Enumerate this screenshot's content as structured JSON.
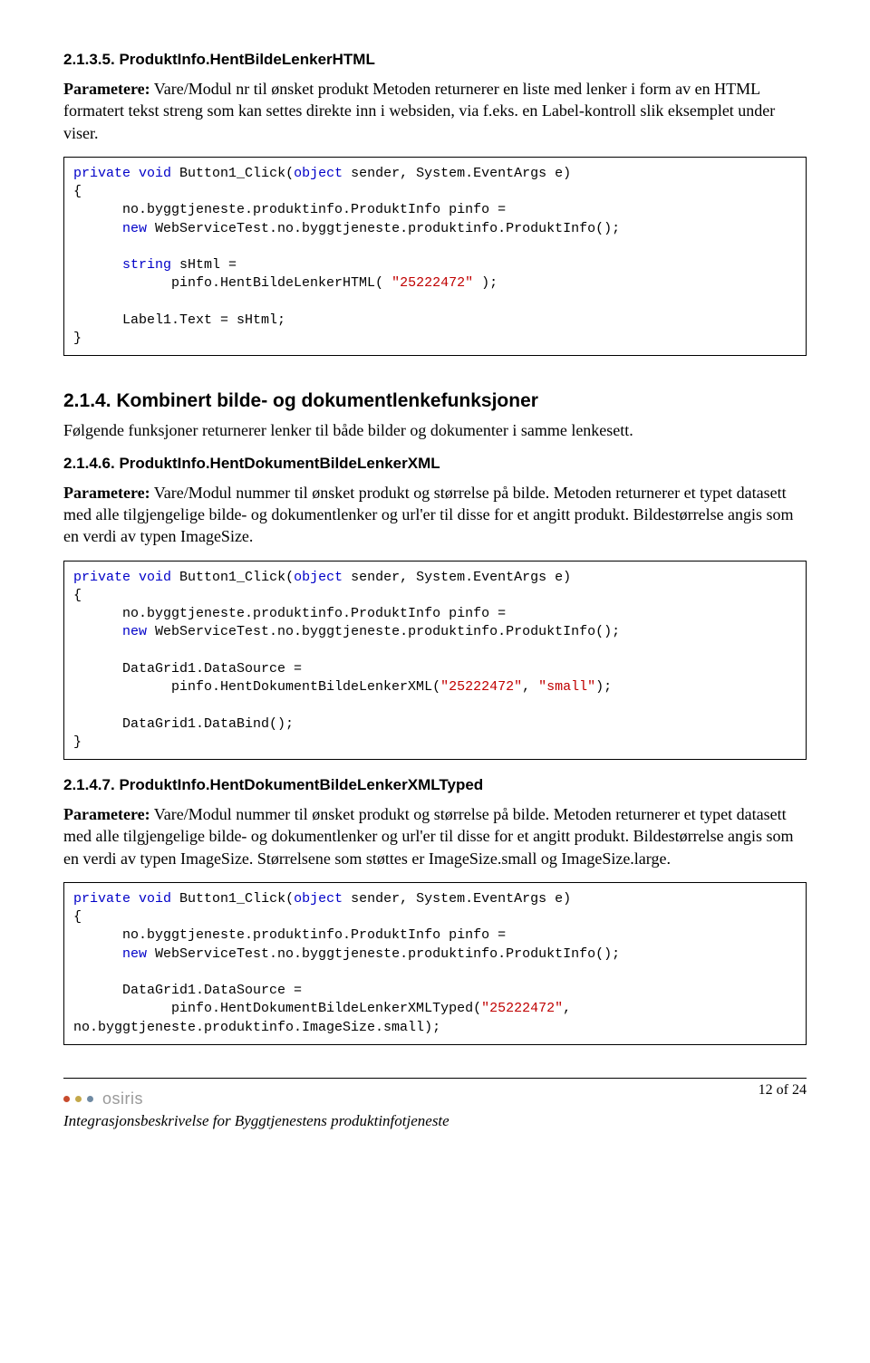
{
  "s1": {
    "num": "2.1.3.5.",
    "title": "ProduktInfo.HentBildeLenkerHTML",
    "para": {
      "label": "Parametere:",
      "rest": " Vare/Modul nr til ønsket produkt\nMetoden returnerer en liste med lenker i form av en HTML formatert tekst streng som kan settes direkte inn i websiden, via f.eks. en Label-kontroll slik eksemplet under viser."
    },
    "code": {
      "kw_private": "private",
      "kw_void": "void",
      "sig": " Button1_Click(",
      "kw_object": "object",
      "sig2": " sender, System.EventArgs e)",
      "l2": "{",
      "l3a": "      no.byggtjeneste.produktinfo.ProduktInfo pinfo = ",
      "kw_new": "new",
      "l4b": " WebServiceTest.no.byggtjeneste.produktinfo.ProduktInfo();",
      "kw_string": "string",
      "l6b": " sHtml = ",
      "l7a": "            pinfo.HentBildeLenkerHTML( ",
      "str1": "\"25222472\"",
      "l7b": " );",
      "l9": "      Label1.Text = sHtml;",
      "l10": "}"
    }
  },
  "s2": {
    "num": "2.1.4.",
    "title": "Kombinert bilde- og dokumentlenkefunksjoner",
    "para": "Følgende funksjoner returnerer lenker til både bilder og dokumenter i samme lenkesett."
  },
  "s3": {
    "num": "2.1.4.6.",
    "title": "ProduktInfo.HentDokumentBildeLenkerXML",
    "para": {
      "label": "Parametere:",
      "rest": " Vare/Modul nummer til ønsket produkt og størrelse på bilde.\nMetoden returnerer et typet datasett med alle tilgjengelige bilde- og dokumentlenker og url'er til disse for et angitt produkt. Bildestørrelse angis som en verdi av typen ImageSize."
    },
    "code": {
      "l6": "      DataGrid1.DataSource = ",
      "l7a": "            pinfo.HentDokumentBildeLenkerXML(",
      "str1": "\"25222472\"",
      "comma": ", ",
      "str2": "\"small\"",
      "l7b": ");",
      "l9": "      DataGrid1.DataBind();"
    }
  },
  "s4": {
    "num": "2.1.4.7.",
    "title": "ProduktInfo.HentDokumentBildeLenkerXMLTyped",
    "para": {
      "label": "Parametere:",
      "rest": " Vare/Modul nummer til ønsket produkt og størrelse på bilde.\nMetoden returnerer et typet datasett med alle tilgjengelige bilde- og dokumentlenker og url'er til disse for et angitt produkt. Bildestørrelse angis som en verdi av typen ImageSize. Størrelsene som støttes er ImageSize.small og ImageSize.large."
    },
    "code": {
      "l6": "      DataGrid1.DataSource = ",
      "l7a": "            pinfo.HentDokumentBildeLenkerXMLTyped(",
      "str1": "\"25222472\"",
      "l7b": ", ",
      "l8": "no.byggtjeneste.produktinfo.ImageSize.small);"
    }
  },
  "footer": {
    "page": "12 of 24",
    "brand": "osiris",
    "doctitle": "Integrasjonsbeskrivelse for Byggtjenestens produktinfotjeneste"
  }
}
